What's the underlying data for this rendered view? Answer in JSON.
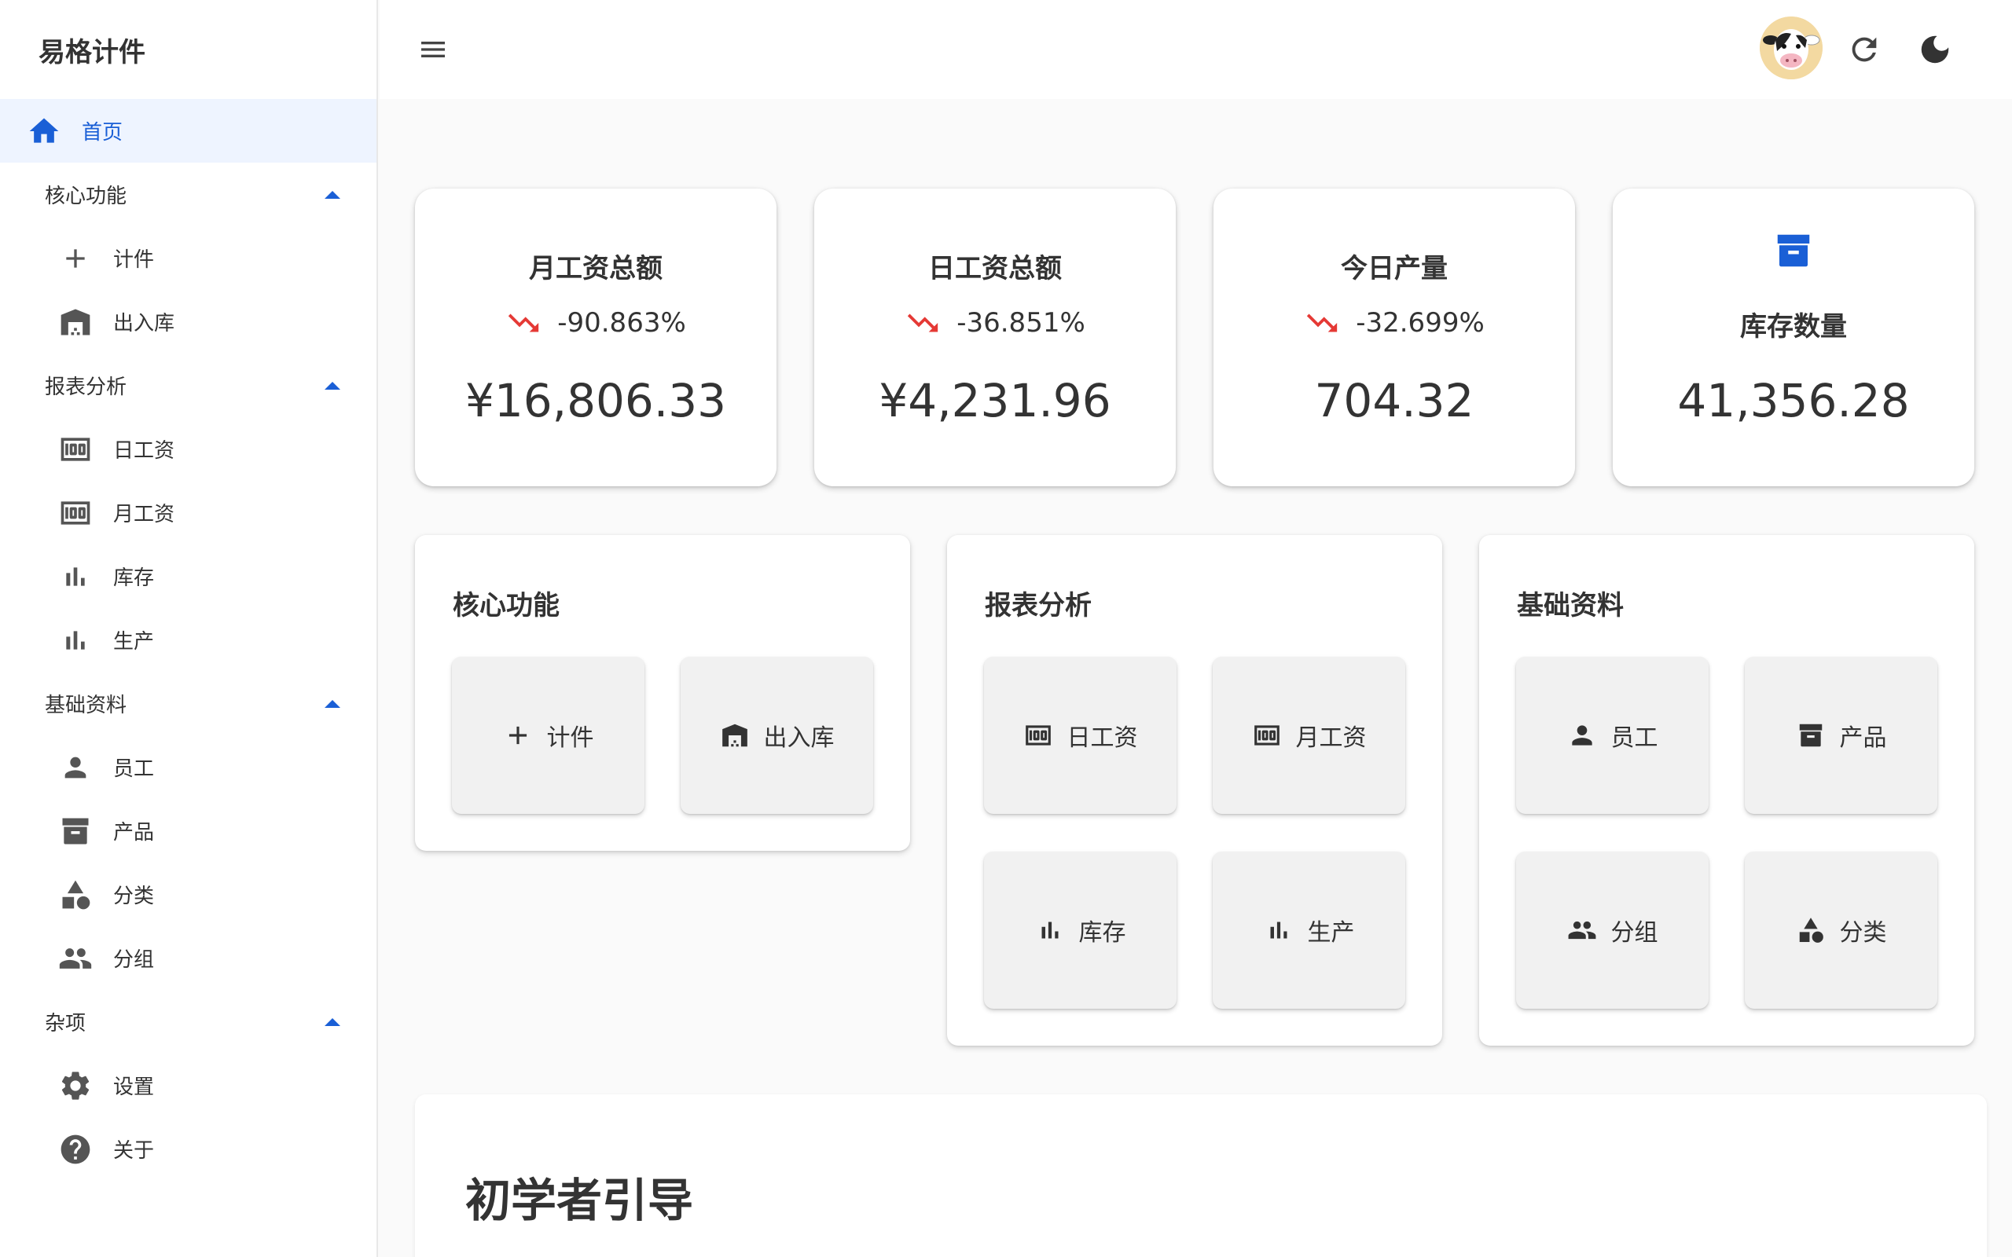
{
  "brand": {
    "name": "易格计件"
  },
  "sidebar": {
    "home": "首页",
    "groups": [
      {
        "label": "核心功能",
        "items": [
          "计件",
          "出入库"
        ]
      },
      {
        "label": "报表分析",
        "items": [
          "日工资",
          "月工资",
          "库存",
          "生产"
        ]
      },
      {
        "label": "基础资料",
        "items": [
          "员工",
          "产品",
          "分类",
          "分组"
        ]
      },
      {
        "label": "杂项",
        "items": [
          "设置",
          "关于"
        ]
      }
    ]
  },
  "stats": [
    {
      "title": "月工资总额",
      "change": "-90.863%",
      "value": "¥16,806.33"
    },
    {
      "title": "日工资总额",
      "change": "-36.851%",
      "value": "¥4,231.96"
    },
    {
      "title": "今日产量",
      "change": "-32.699%",
      "value": "704.32"
    },
    {
      "title": "库存数量",
      "value": "41,356.28"
    }
  ],
  "panels": [
    {
      "title": "核心功能",
      "tiles": [
        "计件",
        "出入库"
      ]
    },
    {
      "title": "报表分析",
      "tiles": [
        "日工资",
        "月工资",
        "库存",
        "生产"
      ]
    },
    {
      "title": "基础资料",
      "tiles": [
        "员工",
        "产品",
        "分组",
        "分类"
      ]
    }
  ],
  "guide": {
    "title": "初学者引导"
  },
  "colors": {
    "accent": "#1a5fd6",
    "trend_down": "#e53935",
    "home_bg": "#eef4ff"
  },
  "icons": {
    "menu": "menu-icon",
    "refresh": "refresh-icon",
    "theme": "dark-mode-icon",
    "home": "home-icon",
    "add": "add-icon",
    "warehouse": "warehouse-icon",
    "money": "money-icon",
    "bar_chart": "bar-chart-icon",
    "person": "person-icon",
    "archive": "archive-icon",
    "category": "category-icon",
    "group": "group-icon",
    "settings": "settings-icon",
    "help": "help-icon",
    "trend_down": "trending-down-icon"
  }
}
